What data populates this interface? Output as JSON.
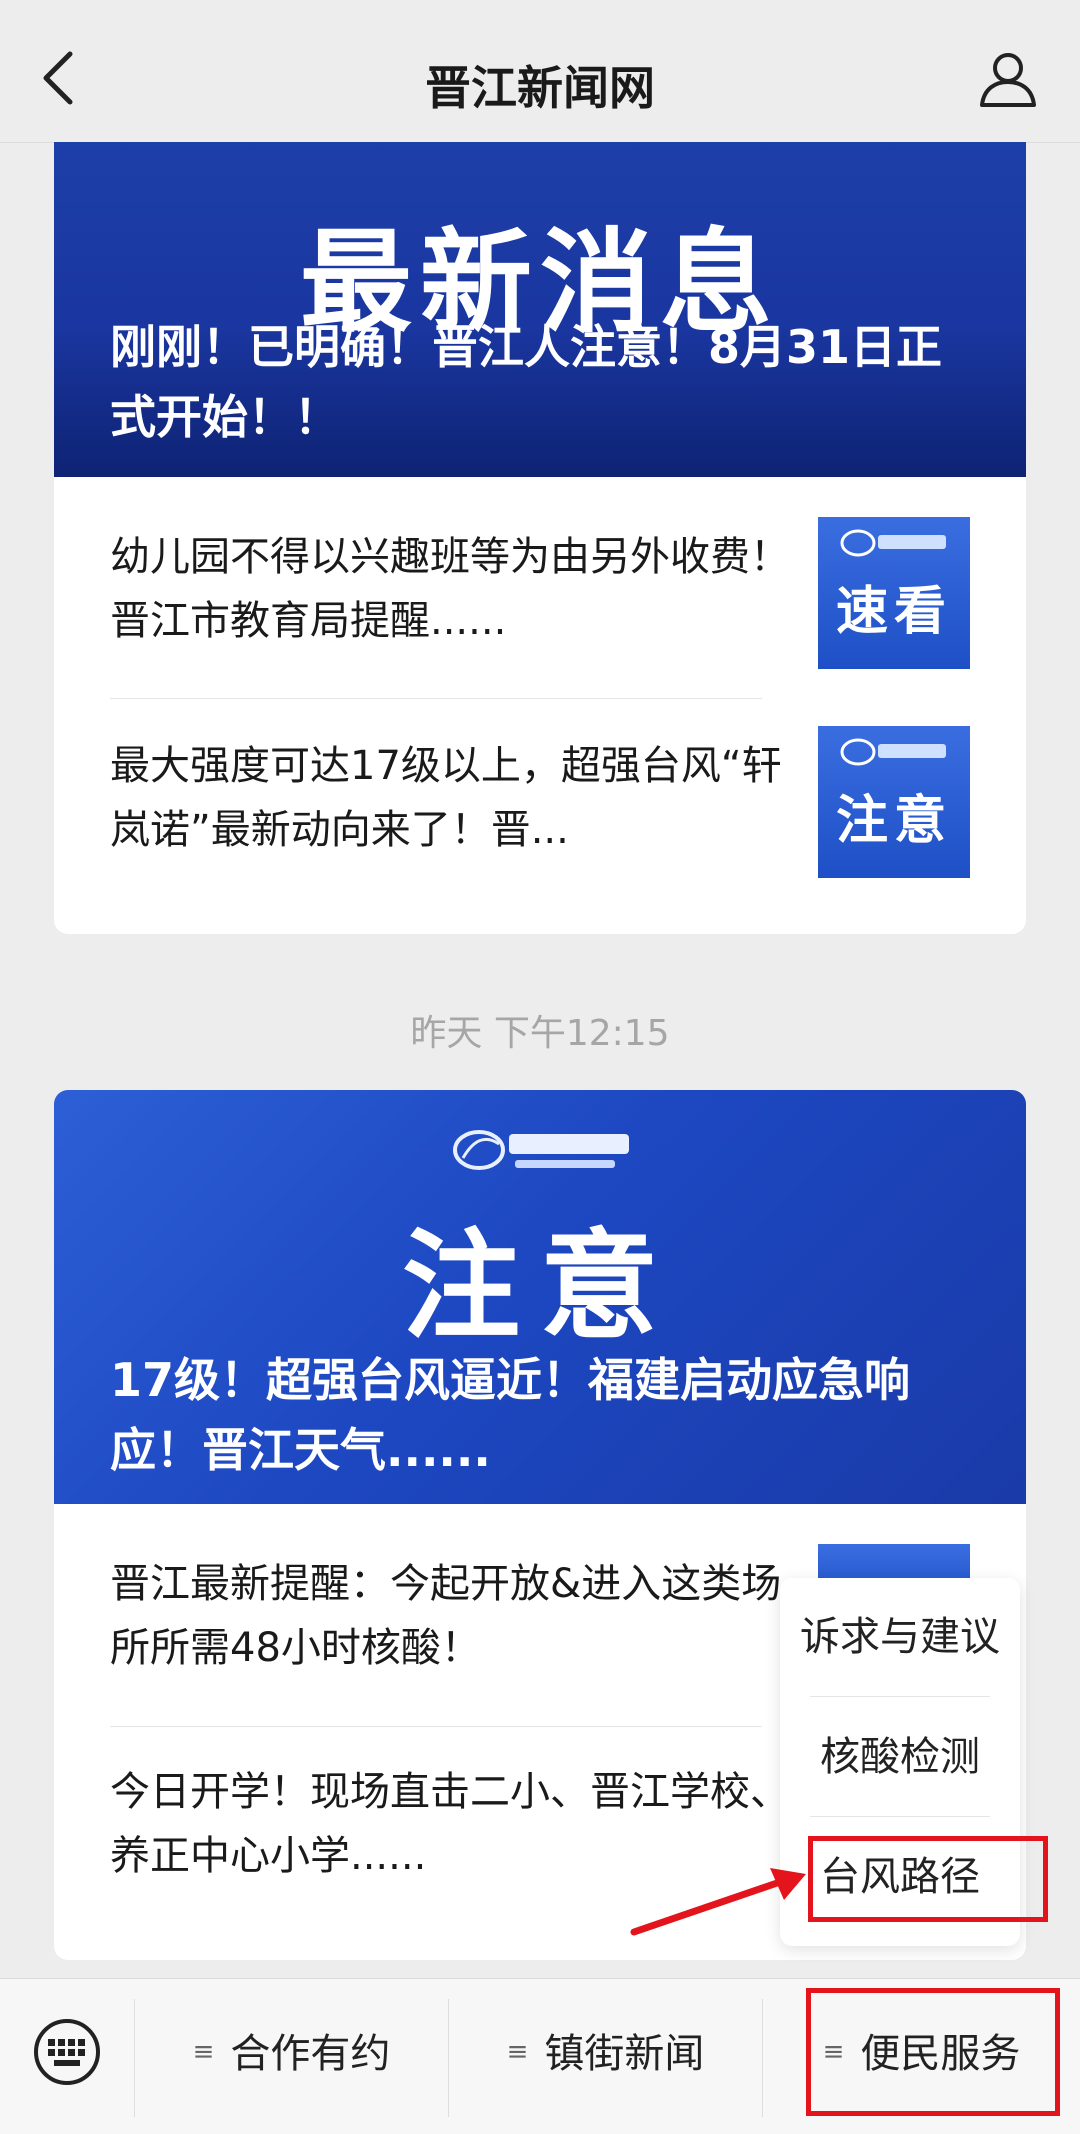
{
  "header": {
    "title": "晋江新闻网"
  },
  "card1": {
    "cover_big": "最新消息",
    "cover_headline": "刚刚！已明确！晋江人注意！8月31日正式开始！！",
    "items": [
      {
        "text": "幼儿园不得以兴趣班等为由另外收费！晋江市教育局提醒......",
        "thumb_label": "速看"
      },
      {
        "text": "最大强度可达17级以上，超强台风“轩岚诺”最新动向来了！晋...",
        "thumb_label": "注意"
      }
    ]
  },
  "timestamp": "昨天 下午12:15",
  "card2": {
    "cover_big": "注意",
    "cover_headline": "17级！超强台风逼近！福建启动应急响应！晋江天气......",
    "items": [
      {
        "text": "晋江最新提醒：今起开放&进入这类场所所需48小时核酸！"
      },
      {
        "text": "今日开学！现场直击二小、晋江学校、养正中心小学......"
      }
    ]
  },
  "popup": {
    "items": [
      "诉求与建议",
      "核酸检测",
      "台风路径"
    ]
  },
  "bottom_menu": {
    "tabs": [
      "合作有约",
      "镇街新闻",
      "便民服务"
    ]
  },
  "colors": {
    "highlight": "#e3141b",
    "cover_blue": "#1d3fa8"
  }
}
